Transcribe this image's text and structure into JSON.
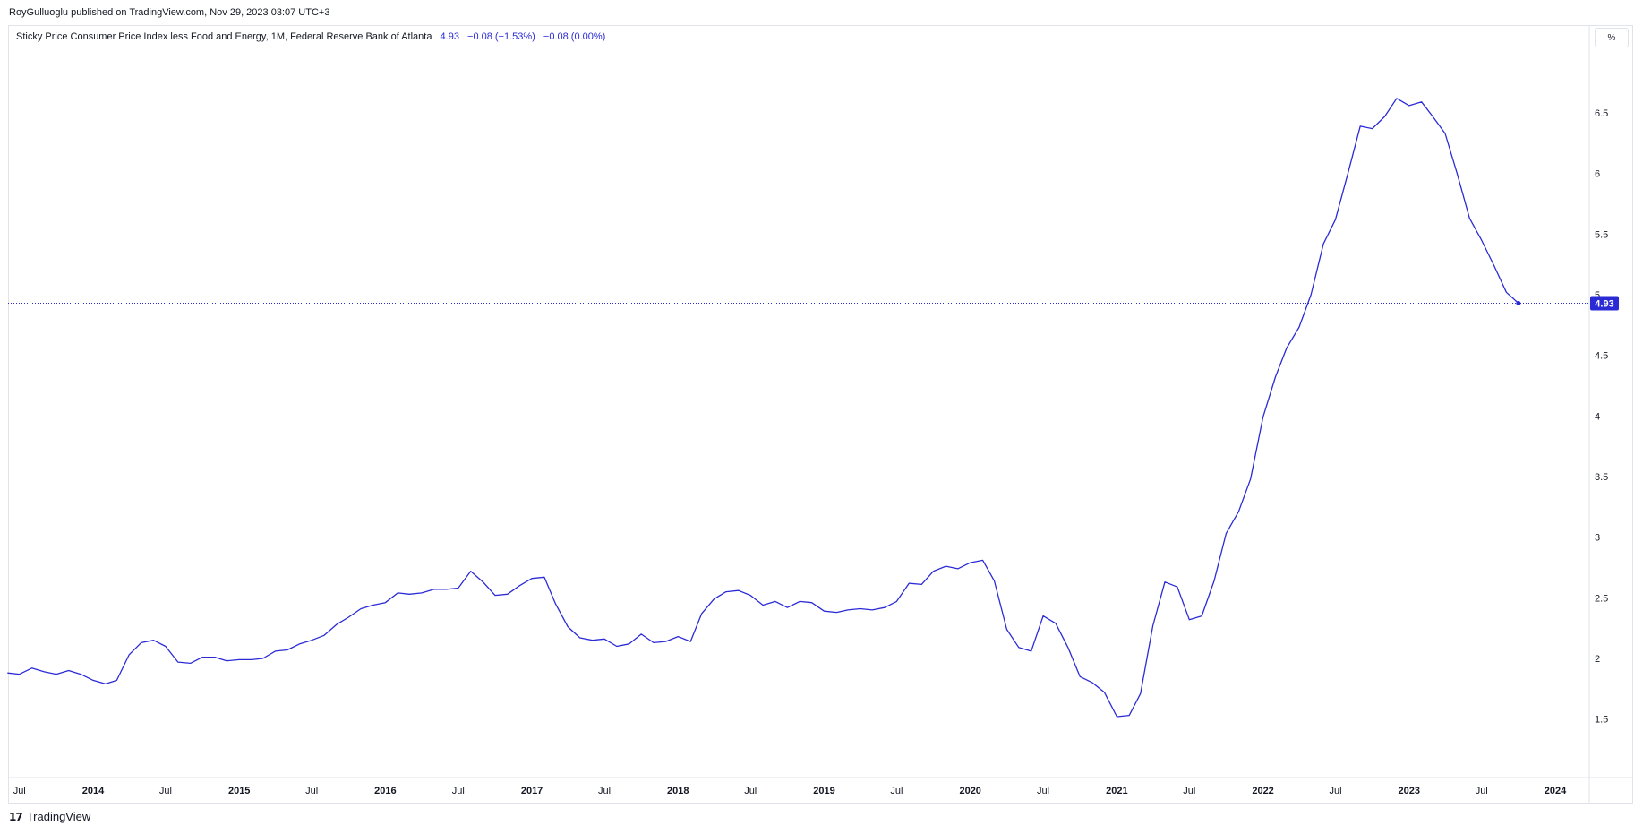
{
  "header": {
    "published_text": "RoyGulluoglu published on TradingView.com, Nov 29, 2023 03:07 UTC+3"
  },
  "legend": {
    "series_title": "Sticky Price Consumer Price Index less Food and Energy, 1M, Federal Reserve Bank of Atlanta",
    "value": "4.93",
    "change": "−0.08 (−1.53%)",
    "change2": "−0.08 (0.00%)"
  },
  "toolbar": {
    "unit_label": "%"
  },
  "footer": {
    "brand": "TradingView",
    "brand_icon": "tradingview-logo-icon"
  },
  "colors": {
    "line": "#2b2bd6",
    "axis_text": "#131722",
    "price_label_bg": "#2b2bd6"
  },
  "chart_data": {
    "type": "line",
    "title": "Sticky Price Consumer Price Index less Food and Energy, 1M, Federal Reserve Bank of Atlanta",
    "ylim": [
      1.0,
      7.0
    ],
    "y_ticks": [
      "1.5",
      "2",
      "2.5",
      "3",
      "3.5",
      "4",
      "4.5",
      "5",
      "5.5",
      "6",
      "6.5"
    ],
    "x_ticks": [
      {
        "label": "Jul",
        "date": "2013-07-01"
      },
      {
        "label": "2014",
        "date": "2014-01-01"
      },
      {
        "label": "Jul",
        "date": "2014-07-01"
      },
      {
        "label": "2015",
        "date": "2015-01-01"
      },
      {
        "label": "Jul",
        "date": "2015-07-01"
      },
      {
        "label": "2016",
        "date": "2016-01-01"
      },
      {
        "label": "Jul",
        "date": "2016-07-01"
      },
      {
        "label": "2017",
        "date": "2017-01-01"
      },
      {
        "label": "Jul",
        "date": "2017-07-01"
      },
      {
        "label": "2018",
        "date": "2018-01-01"
      },
      {
        "label": "Jul",
        "date": "2018-07-01"
      },
      {
        "label": "2019",
        "date": "2019-01-01"
      },
      {
        "label": "Jul",
        "date": "2019-07-01"
      },
      {
        "label": "2020",
        "date": "2020-01-01"
      },
      {
        "label": "Jul",
        "date": "2020-07-01"
      },
      {
        "label": "2021",
        "date": "2021-01-01"
      },
      {
        "label": "Jul",
        "date": "2021-07-01"
      },
      {
        "label": "2022",
        "date": "2022-01-01"
      },
      {
        "label": "Jul",
        "date": "2022-07-01"
      },
      {
        "label": "2023",
        "date": "2023-01-01"
      },
      {
        "label": "Jul",
        "date": "2023-07-01"
      },
      {
        "label": "2024",
        "date": "2024-01-01"
      }
    ],
    "last_value_label": "4.93",
    "last_value": 4.93,
    "grid": false,
    "series": [
      {
        "values": [
          [
            "2013-06-01",
            1.88
          ],
          [
            "2013-07-01",
            1.87
          ],
          [
            "2013-08-01",
            1.92
          ],
          [
            "2013-09-01",
            1.89
          ],
          [
            "2013-10-01",
            1.87
          ],
          [
            "2013-11-01",
            1.9
          ],
          [
            "2013-12-01",
            1.87
          ],
          [
            "2014-01-01",
            1.82
          ],
          [
            "2014-02-01",
            1.79
          ],
          [
            "2014-03-01",
            1.82
          ],
          [
            "2014-04-01",
            2.03
          ],
          [
            "2014-05-01",
            2.13
          ],
          [
            "2014-06-01",
            2.15
          ],
          [
            "2014-07-01",
            2.1
          ],
          [
            "2014-08-01",
            1.97
          ],
          [
            "2014-09-01",
            1.96
          ],
          [
            "2014-10-01",
            2.01
          ],
          [
            "2014-11-01",
            2.01
          ],
          [
            "2014-12-01",
            1.98
          ],
          [
            "2015-01-01",
            1.99
          ],
          [
            "2015-02-01",
            1.99
          ],
          [
            "2015-03-01",
            2.0
          ],
          [
            "2015-04-01",
            2.06
          ],
          [
            "2015-05-01",
            2.07
          ],
          [
            "2015-06-01",
            2.12
          ],
          [
            "2015-07-01",
            2.15
          ],
          [
            "2015-08-01",
            2.19
          ],
          [
            "2015-09-01",
            2.28
          ],
          [
            "2015-10-01",
            2.34
          ],
          [
            "2015-11-01",
            2.41
          ],
          [
            "2015-12-01",
            2.44
          ],
          [
            "2016-01-01",
            2.46
          ],
          [
            "2016-02-01",
            2.54
          ],
          [
            "2016-03-01",
            2.53
          ],
          [
            "2016-04-01",
            2.54
          ],
          [
            "2016-05-01",
            2.57
          ],
          [
            "2016-06-01",
            2.57
          ],
          [
            "2016-07-01",
            2.58
          ],
          [
            "2016-08-01",
            2.72
          ],
          [
            "2016-09-01",
            2.63
          ],
          [
            "2016-10-01",
            2.52
          ],
          [
            "2016-11-01",
            2.53
          ],
          [
            "2016-12-01",
            2.6
          ],
          [
            "2017-01-01",
            2.66
          ],
          [
            "2017-02-01",
            2.67
          ],
          [
            "2017-03-01",
            2.45
          ],
          [
            "2017-04-01",
            2.26
          ],
          [
            "2017-05-01",
            2.17
          ],
          [
            "2017-06-01",
            2.15
          ],
          [
            "2017-07-01",
            2.16
          ],
          [
            "2017-08-01",
            2.1
          ],
          [
            "2017-09-01",
            2.12
          ],
          [
            "2017-10-01",
            2.2
          ],
          [
            "2017-11-01",
            2.13
          ],
          [
            "2017-12-01",
            2.14
          ],
          [
            "2018-01-01",
            2.18
          ],
          [
            "2018-02-01",
            2.14
          ],
          [
            "2018-03-01",
            2.37
          ],
          [
            "2018-04-01",
            2.49
          ],
          [
            "2018-05-01",
            2.55
          ],
          [
            "2018-06-01",
            2.56
          ],
          [
            "2018-07-01",
            2.52
          ],
          [
            "2018-08-01",
            2.44
          ],
          [
            "2018-09-01",
            2.47
          ],
          [
            "2018-10-01",
            2.42
          ],
          [
            "2018-11-01",
            2.47
          ],
          [
            "2018-12-01",
            2.46
          ],
          [
            "2019-01-01",
            2.39
          ],
          [
            "2019-02-01",
            2.38
          ],
          [
            "2019-03-01",
            2.4
          ],
          [
            "2019-04-01",
            2.41
          ],
          [
            "2019-05-01",
            2.4
          ],
          [
            "2019-06-01",
            2.42
          ],
          [
            "2019-07-01",
            2.47
          ],
          [
            "2019-08-01",
            2.62
          ],
          [
            "2019-09-01",
            2.61
          ],
          [
            "2019-10-01",
            2.72
          ],
          [
            "2019-11-01",
            2.76
          ],
          [
            "2019-12-01",
            2.74
          ],
          [
            "2020-01-01",
            2.79
          ],
          [
            "2020-02-01",
            2.81
          ],
          [
            "2020-03-01",
            2.64
          ],
          [
            "2020-04-01",
            2.24
          ],
          [
            "2020-05-01",
            2.09
          ],
          [
            "2020-06-01",
            2.06
          ],
          [
            "2020-07-01",
            2.35
          ],
          [
            "2020-08-01",
            2.29
          ],
          [
            "2020-09-01",
            2.09
          ],
          [
            "2020-10-01",
            1.85
          ],
          [
            "2020-11-01",
            1.8
          ],
          [
            "2020-12-01",
            1.72
          ],
          [
            "2021-01-01",
            1.52
          ],
          [
            "2021-02-01",
            1.53
          ],
          [
            "2021-03-01",
            1.71
          ],
          [
            "2021-04-01",
            2.27
          ],
          [
            "2021-05-01",
            2.63
          ],
          [
            "2021-06-01",
            2.59
          ],
          [
            "2021-07-01",
            2.32
          ],
          [
            "2021-08-01",
            2.35
          ],
          [
            "2021-09-01",
            2.64
          ],
          [
            "2021-10-01",
            3.03
          ],
          [
            "2021-11-01",
            3.21
          ],
          [
            "2021-12-01",
            3.48
          ],
          [
            "2022-01-01",
            3.99
          ],
          [
            "2022-02-01",
            4.32
          ],
          [
            "2022-03-01",
            4.56
          ],
          [
            "2022-04-01",
            4.73
          ],
          [
            "2022-05-01",
            5.0
          ],
          [
            "2022-06-01",
            5.42
          ],
          [
            "2022-07-01",
            5.62
          ],
          [
            "2022-08-01",
            6.0
          ],
          [
            "2022-09-01",
            6.39
          ],
          [
            "2022-10-01",
            6.37
          ],
          [
            "2022-11-01",
            6.47
          ],
          [
            "2022-12-01",
            6.62
          ],
          [
            "2023-01-01",
            6.56
          ],
          [
            "2023-02-01",
            6.59
          ],
          [
            "2023-03-01",
            6.47
          ],
          [
            "2023-04-01",
            6.33
          ],
          [
            "2023-05-01",
            6.0
          ],
          [
            "2023-06-01",
            5.63
          ],
          [
            "2023-07-01",
            5.45
          ],
          [
            "2023-08-01",
            5.24
          ],
          [
            "2023-09-01",
            5.02
          ],
          [
            "2023-10-01",
            4.93
          ]
        ]
      }
    ]
  }
}
